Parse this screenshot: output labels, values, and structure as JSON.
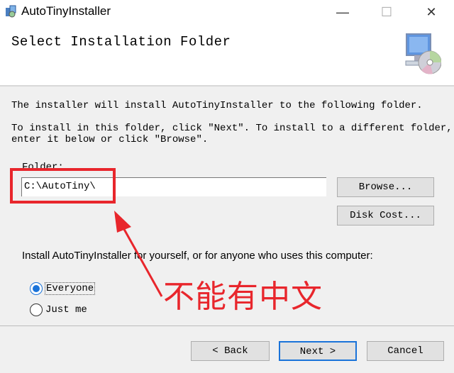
{
  "window": {
    "title": "AutoTinyInstaller",
    "minimize": "—",
    "maximize": "☐",
    "close": "✕"
  },
  "header": {
    "title": "Select Installation Folder",
    "icon": "computer-cd-icon"
  },
  "body": {
    "line1": "The installer will install AutoTinyInstaller to the following folder.",
    "line2": "To install in this folder, click \"Next\". To install to a different folder,",
    "line3": "enter it below or click \"Browse\".",
    "folder_label": "Folder:",
    "folder_value": "C:\\AutoTiny\\",
    "browse": "Browse...",
    "disk_cost": "Disk Cost...",
    "install_for": "Install AutoTinyInstaller for yourself, or for anyone who uses this computer:",
    "radio_everyone": "Everyone",
    "radio_justme": "Just me",
    "selected": "Everyone"
  },
  "annotation": {
    "text": "不能有中文",
    "color": "#e8262c"
  },
  "footer": {
    "back": "< Back",
    "next": "Next >",
    "cancel": "Cancel"
  }
}
